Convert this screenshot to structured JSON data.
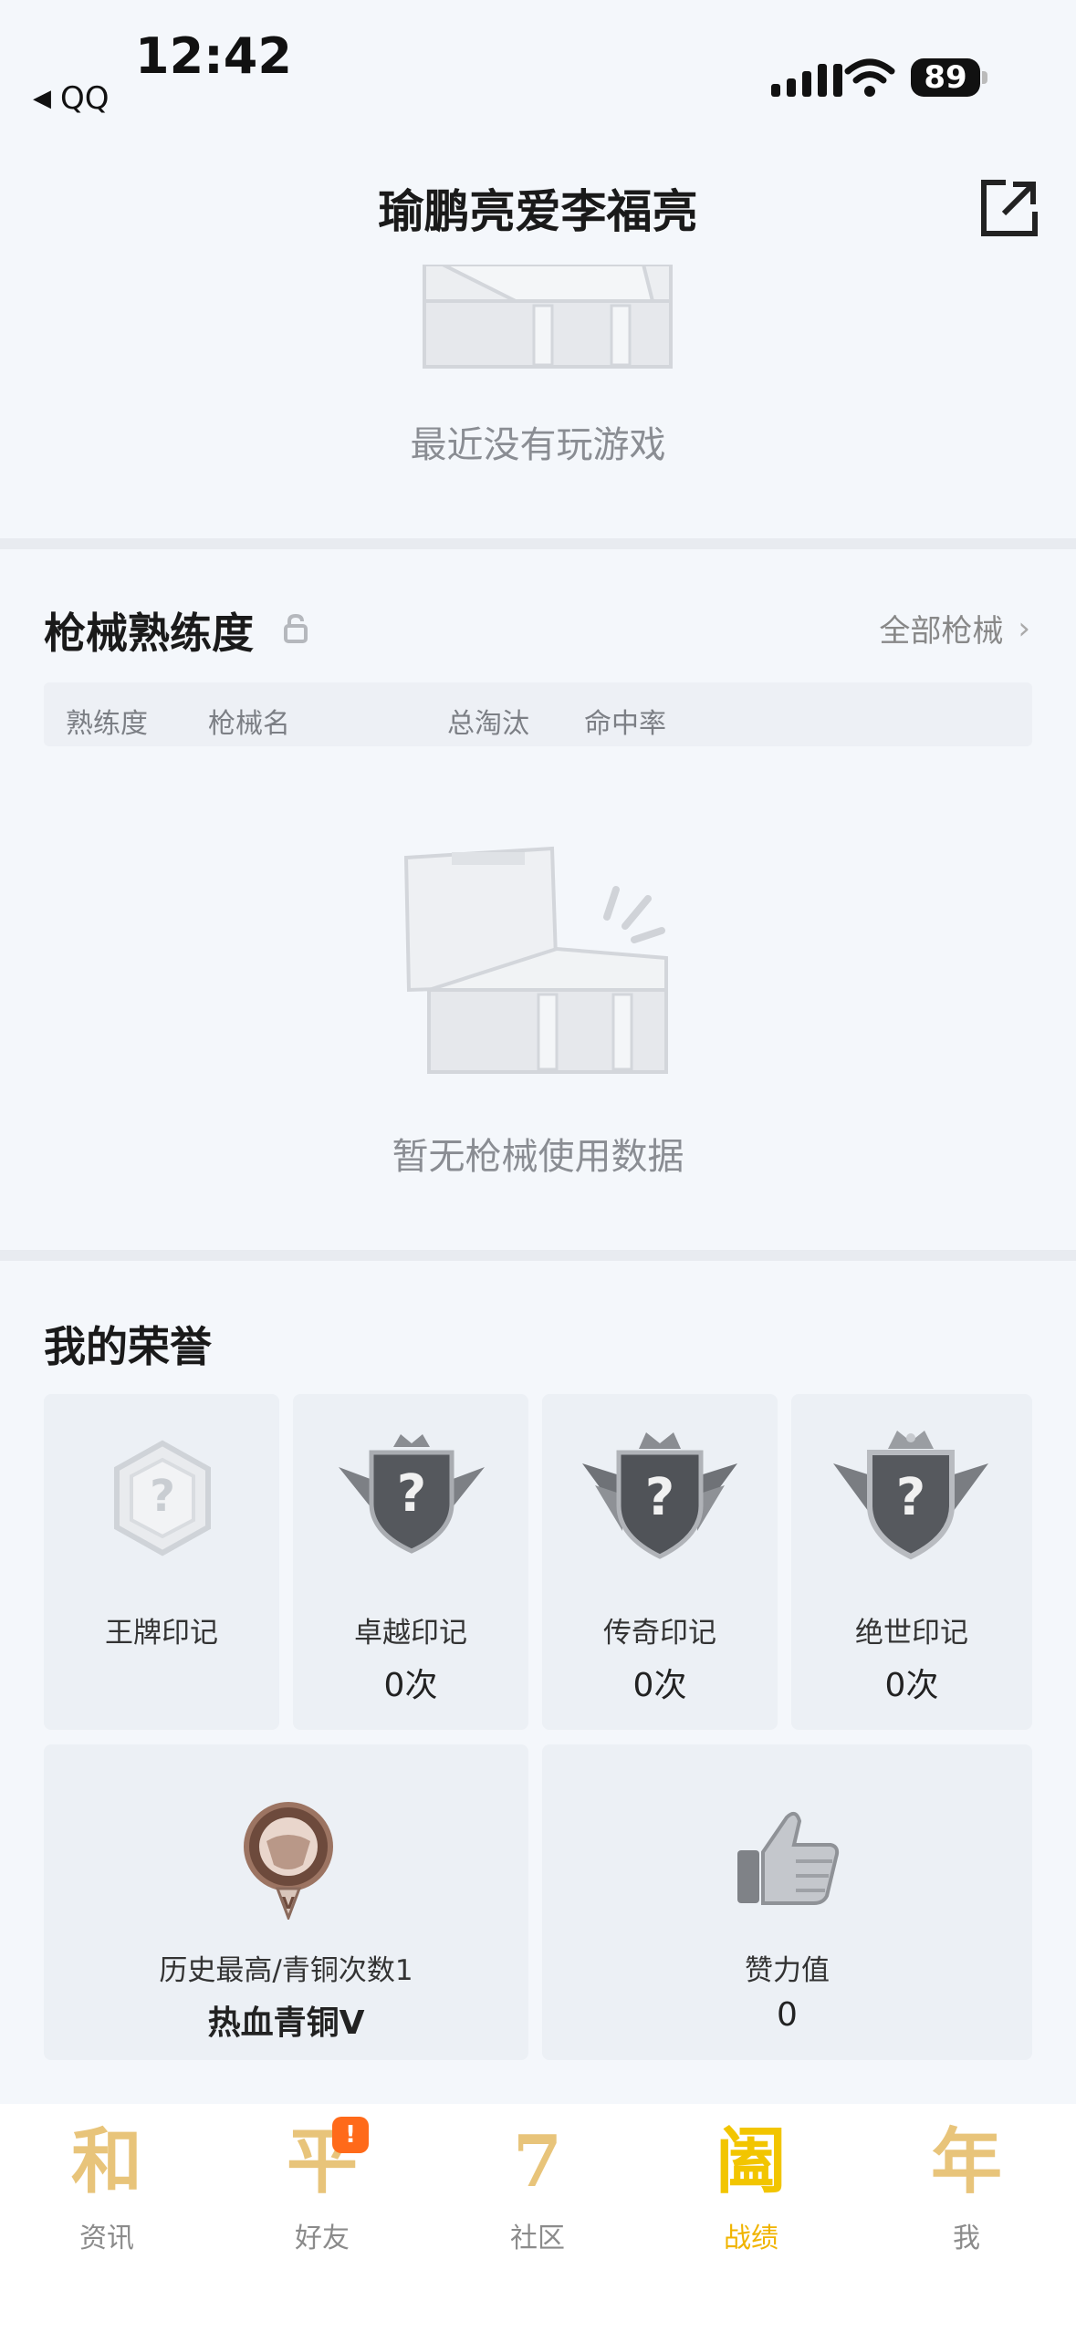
{
  "status_bar": {
    "time": "12:42",
    "back_app": "QQ",
    "battery": "89"
  },
  "header": {
    "title": "瑜鹏亮爱李福亮"
  },
  "recent_games": {
    "empty_text": "最近没有玩游戏"
  },
  "weapon_mastery": {
    "title": "枪械熟练度",
    "all_link": "全部枪械",
    "columns": [
      "熟练度",
      "枪械名",
      "总淘汰",
      "命中率"
    ],
    "empty_text": "暂无枪械使用数据"
  },
  "honors": {
    "title": "我的荣誉",
    "marks": [
      {
        "label": "王牌印记",
        "count": ""
      },
      {
        "label": "卓越印记",
        "count": "0次"
      },
      {
        "label": "传奇印记",
        "count": "0次"
      },
      {
        "label": "绝世印记",
        "count": "0次"
      }
    ],
    "rank_caption": "历史最高/青铜次数1",
    "rank_value": "热血青铜Ⅴ",
    "likes_caption": "赞力值",
    "likes_value": "0"
  },
  "bottom_nav": {
    "items": [
      {
        "glyph": "和",
        "label": "资讯"
      },
      {
        "glyph": "平",
        "label": "好友",
        "badge": "!"
      },
      {
        "glyph": "7",
        "label": "社区"
      },
      {
        "glyph": "阖",
        "label": "战绩"
      },
      {
        "glyph": "年",
        "label": "我"
      }
    ],
    "active": "战绩"
  },
  "colors": {
    "accent": "#f0b400",
    "background": "#f4f7fb",
    "nav_glyph": "#e8c47a",
    "badge": "#ff6a1a"
  }
}
